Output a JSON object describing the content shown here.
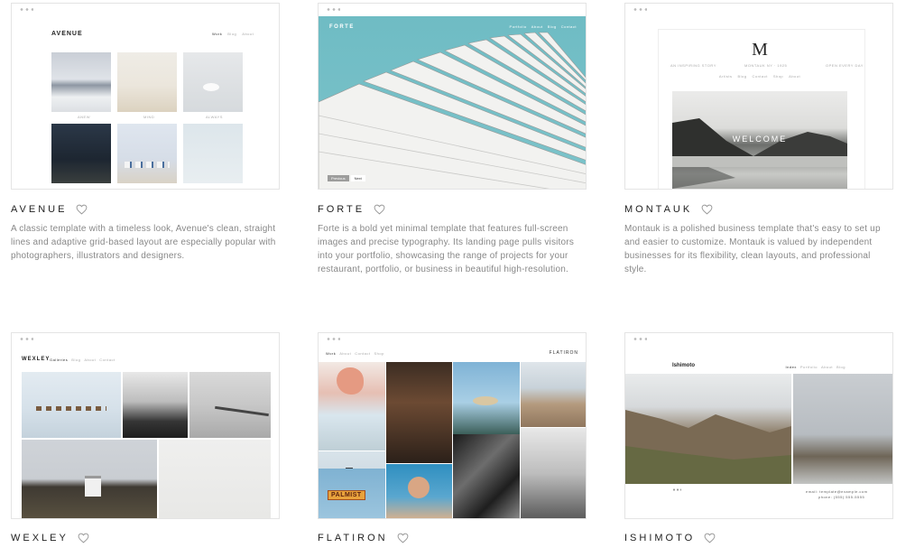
{
  "templates": [
    {
      "name": "AVENUE",
      "description": "A classic template with a timeless look, Avenue's clean, straight lines and adaptive grid-based layout are especially popular with photographers, illustrators and designers.",
      "preview": {
        "logo": "AVENUE",
        "nav": [
          "Work",
          "Blog",
          "About"
        ],
        "captions": [
          "ANEW",
          "MIND",
          "ALWAYS",
          "ISCAT",
          "MARTIN",
          "CLEAR"
        ]
      }
    },
    {
      "name": "FORTE",
      "description": "Forte is a bold yet minimal template that features full-screen images and precise typography. Its landing page pulls visitors into your portfolio, showcasing the range of projects for your restaurant, portfolio, or business in beautiful high-resolution.",
      "preview": {
        "logo": "FORTE",
        "nav": [
          "Portfolio",
          "About",
          "Blog",
          "Contact"
        ],
        "buttons": [
          "Previous",
          "Next"
        ]
      }
    },
    {
      "name": "MONTAUK",
      "description": "Montauk is a polished business template that's easy to set up and easier to customize. Montauk is valued by independent businesses for its flexibility, clean layouts, and professional style.",
      "preview": {
        "logo": "M",
        "tagline_left": "AN INSPIRING STORY",
        "tagline_center": "MONTAUK NY · 1925",
        "tagline_right": "OPEN EVERY DAY",
        "nav": [
          "Artists",
          "Blog",
          "Contact",
          "Shop",
          "About"
        ],
        "hero_text": "WELCOME"
      }
    },
    {
      "name": "WEXLEY",
      "description": "",
      "preview": {
        "logo": "WEXLEY",
        "nav": [
          "Galleries",
          "Blog",
          "About",
          "Contact"
        ]
      }
    },
    {
      "name": "FLATIRON",
      "description": "",
      "preview": {
        "logo": "FLATIRON",
        "nav": [
          "Work",
          "About",
          "Contact",
          "Shop"
        ],
        "sign_text": "PALMIST"
      }
    },
    {
      "name": "ISHIMOTO",
      "description": "",
      "preview": {
        "logo": "Ishimoto",
        "nav": [
          "Index",
          "Portfolio",
          "About",
          "Blog"
        ],
        "contact_line1": "email: template@example.com",
        "contact_line2": "phone: (555) 555-5555"
      }
    }
  ],
  "colors": {
    "title": "#222222",
    "description": "#888888",
    "border": "#e4e4e4",
    "forte_sky": "#6fbcc4"
  },
  "icons": {
    "favorite": "heart-outline-icon",
    "window": "window-dots-icon"
  }
}
